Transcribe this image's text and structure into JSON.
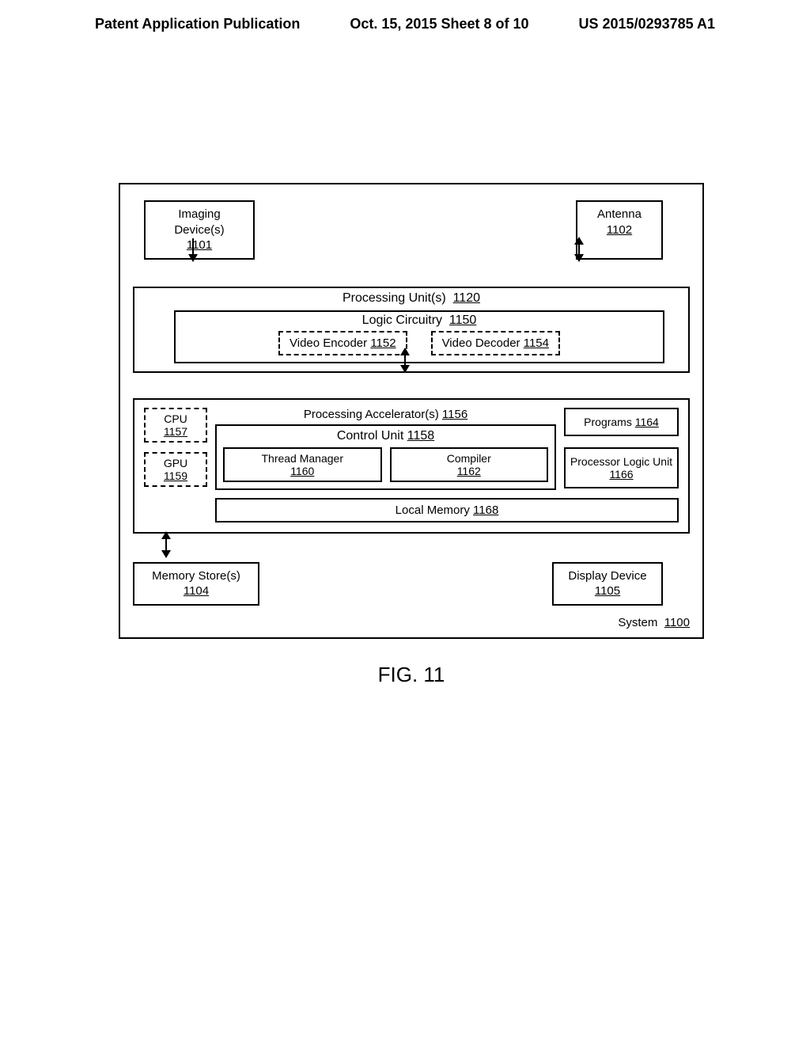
{
  "header": {
    "left": "Patent Application Publication",
    "middle": "Oct. 15, 2015  Sheet 8 of 10",
    "right": "US 2015/0293785 A1"
  },
  "blocks": {
    "imaging": {
      "label": "Imaging Device(s)",
      "ref": "1101"
    },
    "antenna": {
      "label": "Antenna",
      "ref": "1102"
    },
    "processing_unit": {
      "label": "Processing Unit(s)",
      "ref": "1120"
    },
    "logic": {
      "label": "Logic Circuitry",
      "ref": "1150"
    },
    "encoder": {
      "label": "Video Encoder",
      "ref": "1152"
    },
    "decoder": {
      "label": "Video Decoder",
      "ref": "1154"
    },
    "accelerators": {
      "label": "Processing Accelerator(s)",
      "ref": "1156"
    },
    "cpu": {
      "label": "CPU",
      "ref": "1157"
    },
    "gpu": {
      "label": "GPU",
      "ref": "1159"
    },
    "control_unit": {
      "label": "Control Unit",
      "ref": "1158"
    },
    "thread_mgr": {
      "label": "Thread Manager",
      "ref": "1160"
    },
    "compiler": {
      "label": "Compiler",
      "ref": "1162"
    },
    "programs": {
      "label": "Programs",
      "ref": "1164"
    },
    "logic_unit": {
      "label": "Processor Logic Unit",
      "ref": "1166"
    },
    "local_mem": {
      "label": "Local Memory",
      "ref": "1168"
    },
    "mem_store": {
      "label": "Memory Store(s)",
      "ref": "1104"
    },
    "display": {
      "label": "Display Device",
      "ref": "1105"
    },
    "system": {
      "label": "System",
      "ref": "1100"
    }
  },
  "figure": "FIG. 11"
}
